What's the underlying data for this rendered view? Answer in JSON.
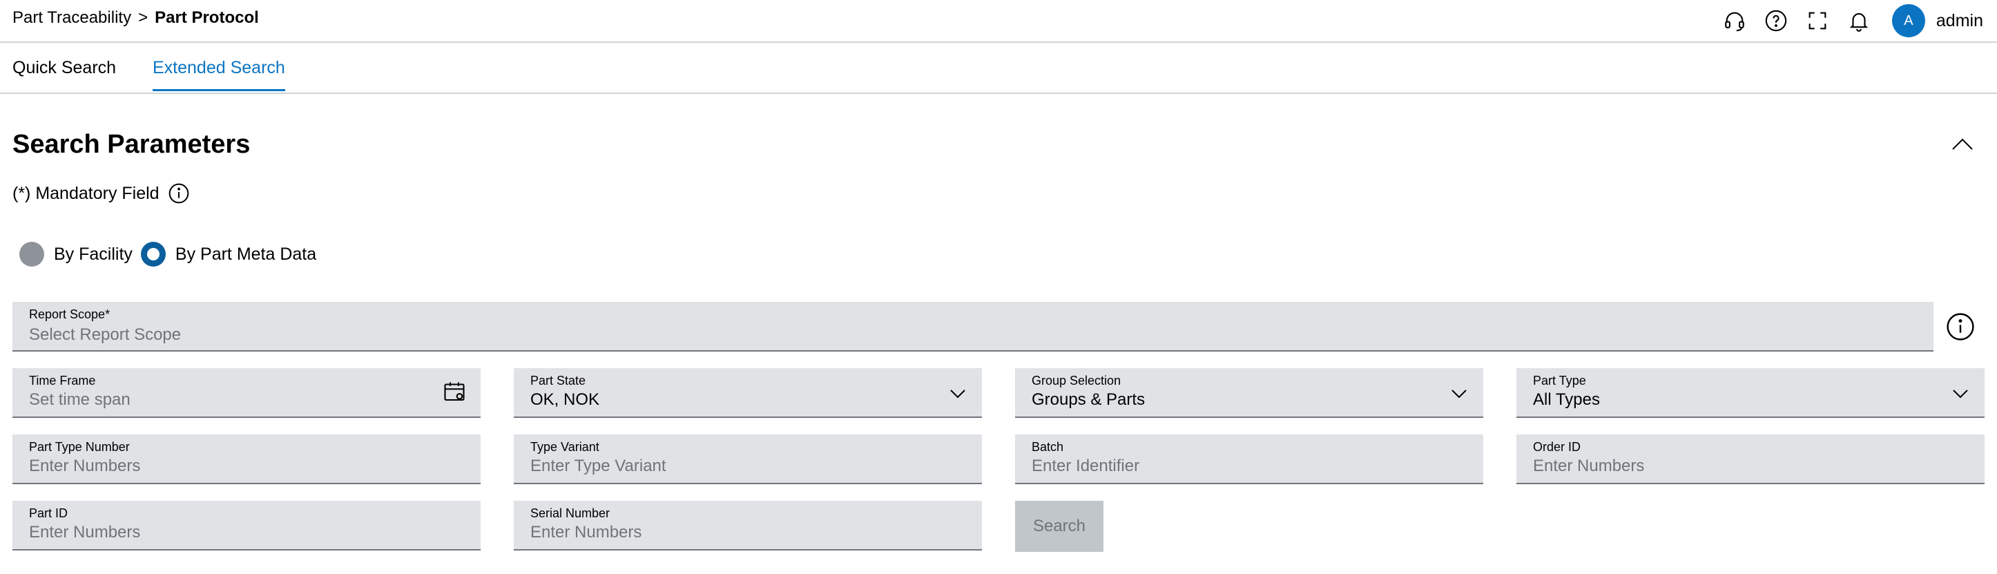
{
  "breadcrumb": {
    "parent": "Part Traceability",
    "separator": ">",
    "current": "Part Protocol"
  },
  "header": {
    "icons": [
      "headset-icon",
      "help-icon",
      "fullscreen-icon",
      "bell-icon"
    ],
    "avatar_initial": "A",
    "user_name": "admin",
    "accent_color": "#0b74c2"
  },
  "tabs": [
    {
      "label": "Quick Search",
      "active": false
    },
    {
      "label": "Extended Search",
      "active": true
    }
  ],
  "section": {
    "title": "Search Parameters",
    "mandatory_note": "(*) Mandatory Field"
  },
  "search_mode": {
    "options": [
      "By Facility",
      "By Part Meta Data"
    ],
    "selected": "By Part Meta Data"
  },
  "fields": {
    "report_scope": {
      "label": "Report Scope*",
      "placeholder": "Select Report Scope"
    },
    "time_frame": {
      "label": "Time Frame",
      "placeholder": "Set time span"
    },
    "part_state": {
      "label": "Part State",
      "value": "OK, NOK"
    },
    "group_selection": {
      "label": "Group Selection",
      "value": "Groups & Parts"
    },
    "part_type": {
      "label": "Part Type",
      "value": "All Types"
    },
    "part_type_number": {
      "label": "Part Type Number",
      "placeholder": "Enter Numbers"
    },
    "type_variant": {
      "label": "Type Variant",
      "placeholder": "Enter Type Variant"
    },
    "batch": {
      "label": "Batch",
      "placeholder": "Enter Identifier"
    },
    "order_id": {
      "label": "Order ID",
      "placeholder": "Enter Numbers"
    },
    "part_id": {
      "label": "Part ID",
      "placeholder": "Enter Numbers"
    },
    "serial_number": {
      "label": "Serial Number",
      "placeholder": "Enter Numbers"
    }
  },
  "actions": {
    "search_label": "Search"
  }
}
